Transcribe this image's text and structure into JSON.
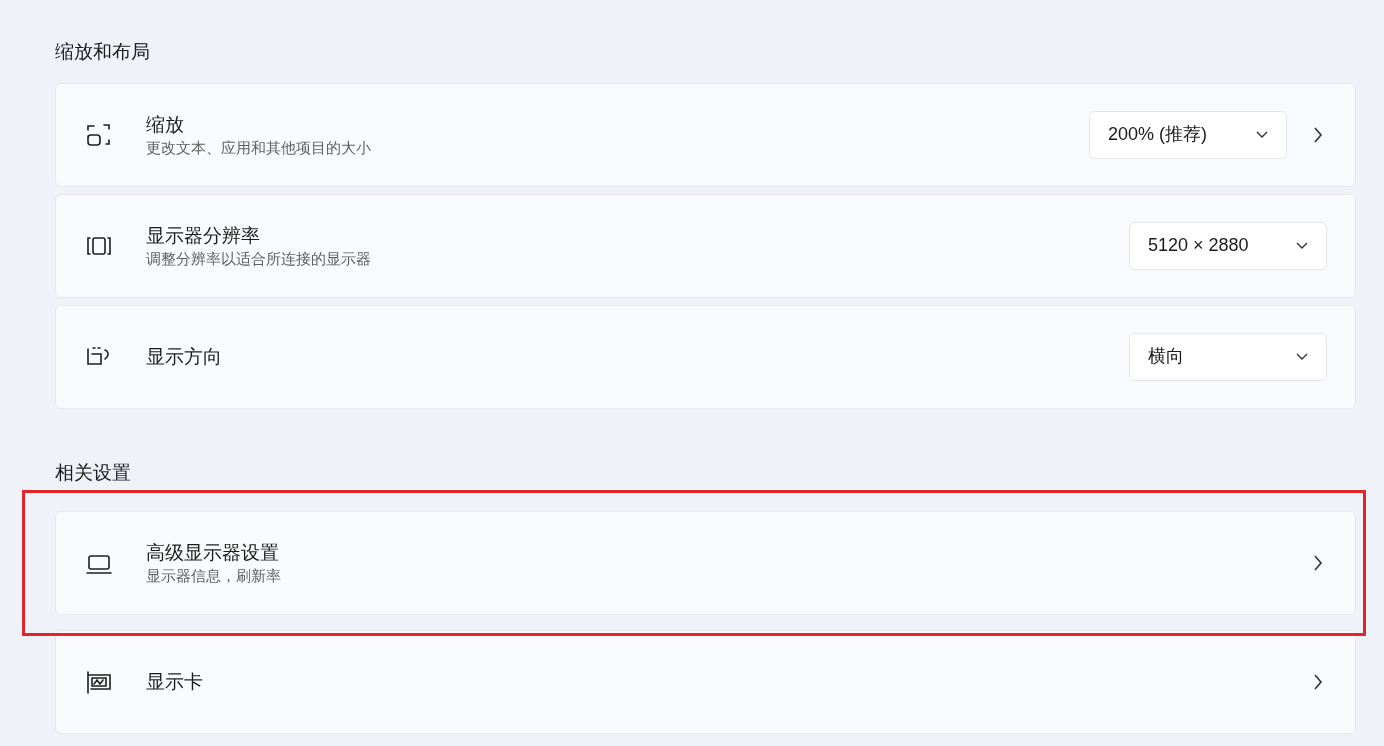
{
  "sections": [
    {
      "title": "缩放和布局",
      "items": [
        {
          "title": "缩放",
          "subtitle": "更改文本、应用和其他项目的大小",
          "dropdown": "200% (推荐)",
          "chevron": true,
          "highlighted": false
        },
        {
          "title": "显示器分辨率",
          "subtitle": "调整分辨率以适合所连接的显示器",
          "dropdown": "5120 × 2880",
          "chevron": false,
          "highlighted": false
        },
        {
          "title": "显示方向",
          "dropdown": "横向",
          "chevron": false,
          "highlighted": false
        }
      ]
    },
    {
      "title": "相关设置",
      "items": [
        {
          "title": "高级显示器设置",
          "subtitle": "显示器信息，刷新率",
          "chevron": true,
          "highlighted": true
        },
        {
          "title": "显示卡",
          "chevron": true,
          "highlighted": false
        }
      ]
    }
  ]
}
